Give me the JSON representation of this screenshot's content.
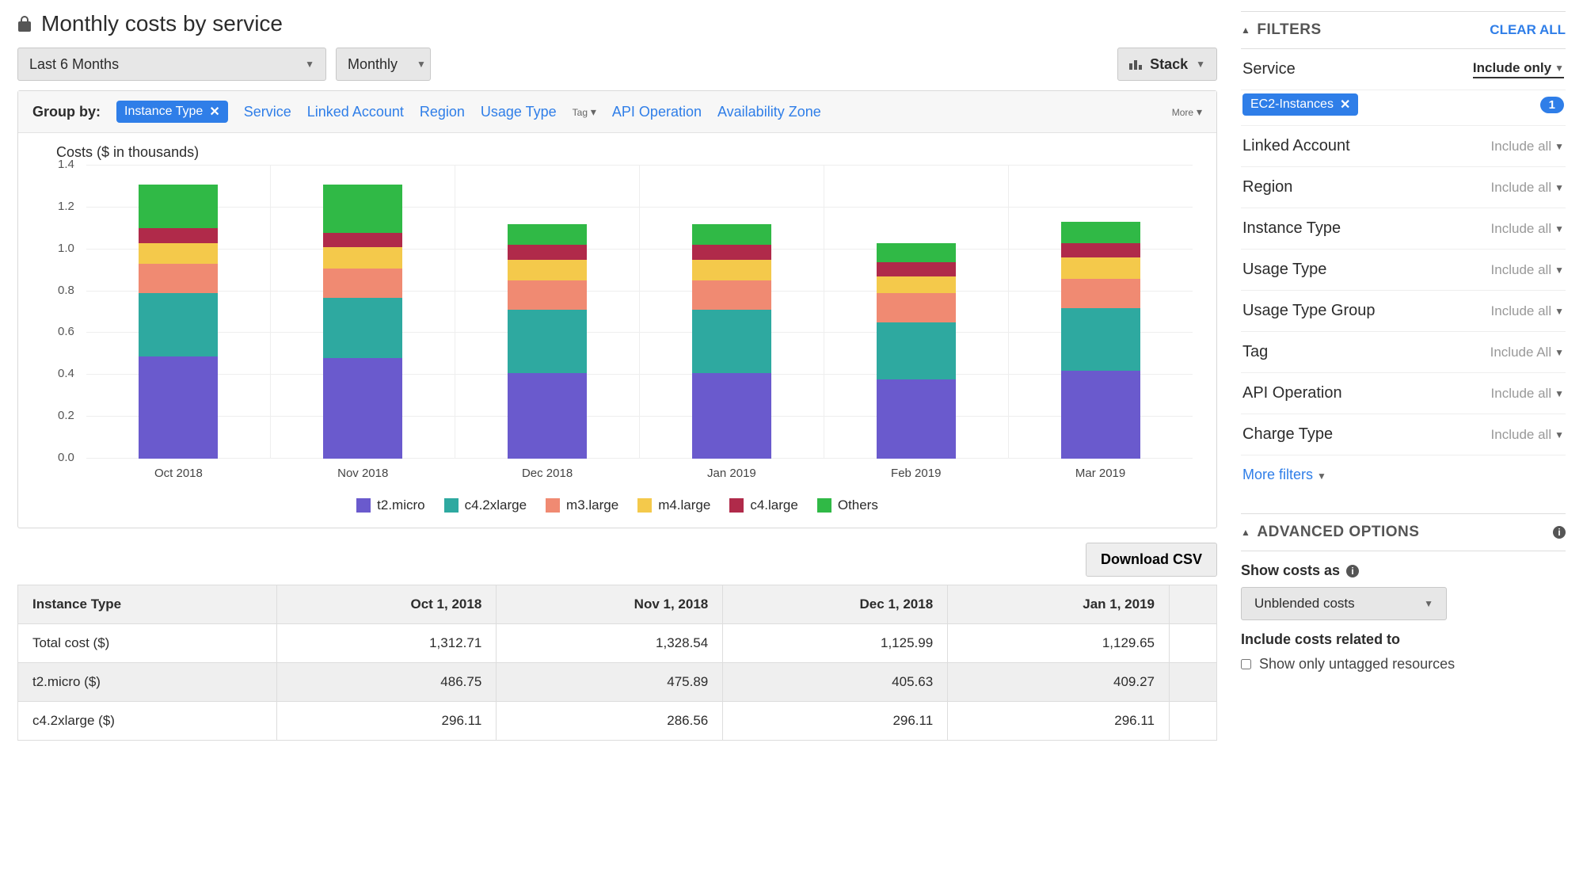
{
  "title": "Monthly costs by service",
  "toolbar": {
    "date_range": "Last 6 Months",
    "granularity": "Monthly",
    "chart_style": "Stack"
  },
  "groupby": {
    "label": "Group by:",
    "selected": "Instance Type",
    "options": [
      "Service",
      "Linked Account",
      "Region",
      "Usage Type",
      "Tag",
      "API Operation",
      "Availability Zone"
    ],
    "more": "More"
  },
  "chart_data": {
    "type": "bar",
    "title": "Costs ($ in thousands)",
    "ylabel": "Costs ($ in thousands)",
    "ylim": [
      0,
      1.4
    ],
    "yticks": [
      0.0,
      0.2,
      0.4,
      0.6,
      0.8,
      1.0,
      1.2,
      1.4
    ],
    "categories": [
      "Oct 2018",
      "Nov 2018",
      "Dec 2018",
      "Jan 2019",
      "Feb 2019",
      "Mar 2019"
    ],
    "series": [
      {
        "name": "t2.micro",
        "color": "#6a5acd",
        "values": [
          0.49,
          0.48,
          0.41,
          0.41,
          0.38,
          0.42
        ]
      },
      {
        "name": "c4.2xlarge",
        "color": "#2ea9a0",
        "values": [
          0.3,
          0.29,
          0.3,
          0.3,
          0.27,
          0.3
        ]
      },
      {
        "name": "m3.large",
        "color": "#f08a72",
        "values": [
          0.14,
          0.14,
          0.14,
          0.14,
          0.14,
          0.14
        ]
      },
      {
        "name": "m4.large",
        "color": "#f4c94b",
        "values": [
          0.1,
          0.1,
          0.1,
          0.1,
          0.08,
          0.1
        ]
      },
      {
        "name": "c4.large",
        "color": "#b02a4a",
        "values": [
          0.07,
          0.07,
          0.07,
          0.07,
          0.07,
          0.07
        ]
      },
      {
        "name": "Others",
        "color": "#30b946",
        "values": [
          0.21,
          0.23,
          0.1,
          0.1,
          0.09,
          0.1
        ]
      }
    ]
  },
  "download_label": "Download CSV",
  "table": {
    "headers": [
      "Instance Type",
      "Oct 1, 2018",
      "Nov 1, 2018",
      "Dec 1, 2018",
      "Jan 1, 2019"
    ],
    "rows": [
      [
        "Total cost ($)",
        "1,312.71",
        "1,328.54",
        "1,125.99",
        "1,129.65"
      ],
      [
        "t2.micro ($)",
        "486.75",
        "475.89",
        "405.63",
        "409.27"
      ],
      [
        "c4.2xlarge ($)",
        "296.11",
        "286.56",
        "296.11",
        "296.11"
      ]
    ]
  },
  "filters": {
    "title": "FILTERS",
    "clear": "CLEAR ALL",
    "service": {
      "label": "Service",
      "val": "Include only",
      "chip": "EC2-Instances",
      "count": "1"
    },
    "rows": [
      {
        "label": "Linked Account",
        "val": "Include all"
      },
      {
        "label": "Region",
        "val": "Include all"
      },
      {
        "label": "Instance Type",
        "val": "Include all"
      },
      {
        "label": "Usage Type",
        "val": "Include all"
      },
      {
        "label": "Usage Type Group",
        "val": "Include all"
      },
      {
        "label": "Tag",
        "val": "Include All"
      },
      {
        "label": "API Operation",
        "val": "Include all"
      },
      {
        "label": "Charge Type",
        "val": "Include all"
      }
    ],
    "more": "More filters"
  },
  "advanced": {
    "title": "ADVANCED OPTIONS",
    "show_costs_label": "Show costs as",
    "show_costs_value": "Unblended costs",
    "include_label": "Include costs related to",
    "checkbox_label": "Show only untagged resources"
  }
}
